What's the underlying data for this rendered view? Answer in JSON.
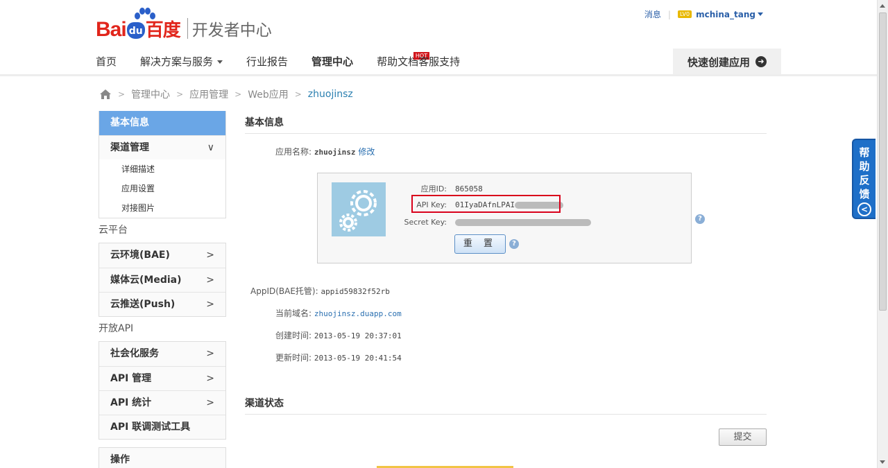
{
  "header": {
    "logo_bai": "Bai",
    "logo_du": "du",
    "logo_baidu_cn": "百度",
    "logo_dev_center": "开发者中心",
    "messages": "消息",
    "level": "LV0",
    "username": "mchina_tang"
  },
  "nav": {
    "items": [
      "首页",
      "解决方案与服务",
      "行业报告",
      "管理中心",
      "帮助文档",
      "客服支持"
    ],
    "hot": "HOT",
    "quick_create": "快速创建应用"
  },
  "breadcrumb": [
    "管理中心",
    "应用管理",
    "Web应用",
    "zhuojinsz"
  ],
  "sidebar": {
    "title": "基本信息",
    "channel": "渠道管理",
    "channel_subs": [
      "详细描述",
      "应用设置",
      "对接图片"
    ],
    "group_cloud": "云平台",
    "cloud_items": [
      "云环境(BAE)",
      "媒体云(Media)",
      "云推送(Push)"
    ],
    "group_api": "开放API",
    "api_items": [
      "社会化服务",
      "API 管理",
      "API 统计",
      "API 联调测试工具"
    ],
    "ops": "操作"
  },
  "main": {
    "basic_title": "基本信息",
    "app_name_label": "应用名称:",
    "app_name": "zhuojinsz",
    "edit": "修改",
    "app_id_label": "应用ID:",
    "app_id": "865058",
    "api_key_label": "API Key:",
    "api_key": "01IyaDAfnLPAI",
    "secret_key_label": "Secret Key:",
    "reset": "重 置",
    "help": "?",
    "bae_appid_label": "AppID(BAE托管):",
    "bae_appid": "appid59832f52rb",
    "domain_label": "当前域名:",
    "domain": "zhuojinsz.duapp.com",
    "created_label": "创建时间:",
    "created": "2013-05-19 20:37:01",
    "updated_label": "更新时间:",
    "updated": "2013-05-19 20:41:54",
    "channel_status_title": "渠道状态",
    "submit": "提交"
  },
  "feedback": {
    "chars": [
      "帮",
      "助",
      "反",
      "馈"
    ]
  }
}
